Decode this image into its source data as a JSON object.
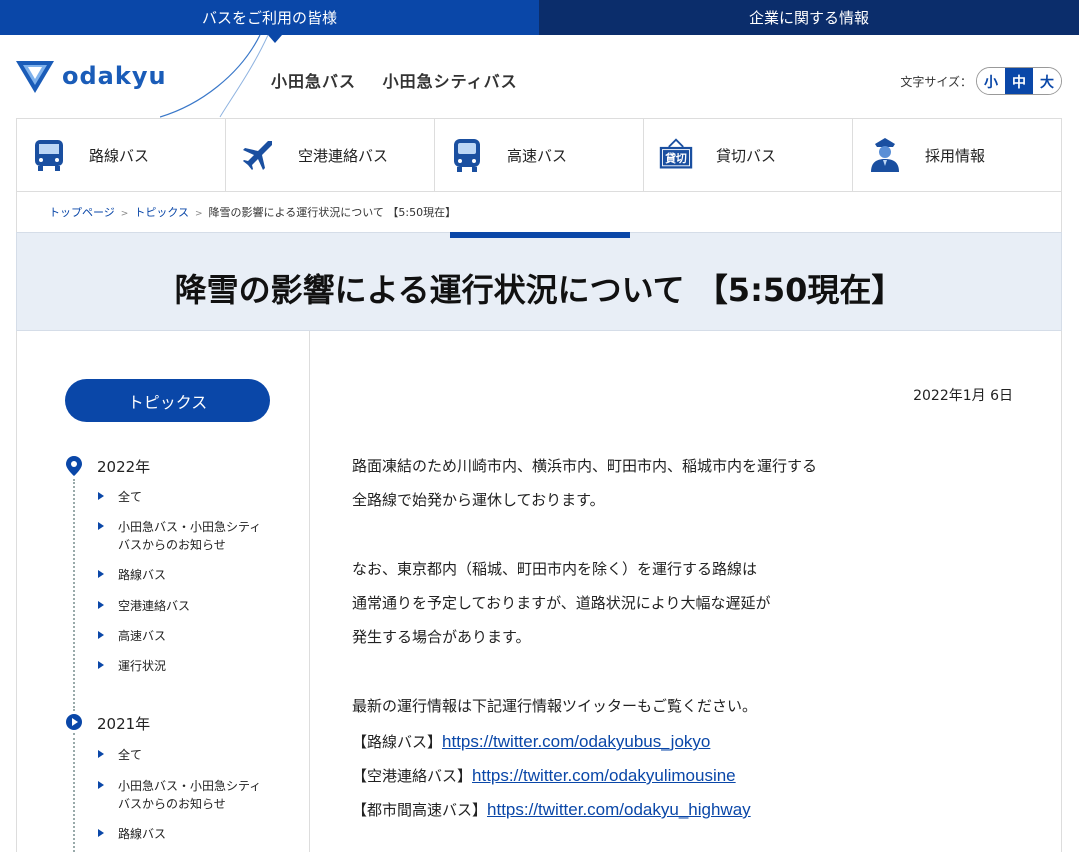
{
  "top_tabs": {
    "customer": "バスをご利用の皆様",
    "corporate": "企業に関する情報"
  },
  "header": {
    "logo_text": "odakyu",
    "company_1": "小田急バス",
    "company_2": "小田急シティバス",
    "fontsize_label": "文字サイズ：",
    "fontsize_small": "小",
    "fontsize_medium": "中",
    "fontsize_large": "大"
  },
  "nav": {
    "items": [
      {
        "label": "路線バス",
        "icon": "bus-front-icon"
      },
      {
        "label": "空港連絡バス",
        "icon": "airplane-icon"
      },
      {
        "label": "高速バス",
        "icon": "highway-bus-icon"
      },
      {
        "label": "貸切バス",
        "icon": "charter-sign-icon"
      },
      {
        "label": "採用情報",
        "icon": "staff-person-icon"
      }
    ]
  },
  "breadcrumb": {
    "home": "トップページ",
    "topics": "トピックス",
    "current": "降雪の影響による運行状況について 【5:50現在】"
  },
  "page_title": "降雪の影響による運行状況について 【5:50現在】",
  "sidebar": {
    "topics_button": "トピックス",
    "years": [
      {
        "year": "2022年",
        "categories": [
          "全て",
          "小田急バス・小田急シティバスからのお知らせ",
          "路線バス",
          "空港連絡バス",
          "高速バス",
          "運行状況"
        ]
      },
      {
        "year": "2021年",
        "categories": [
          "全て",
          "小田急バス・小田急シティバスからのお知らせ",
          "路線バス"
        ]
      }
    ]
  },
  "article": {
    "date": "2022年1月 6日",
    "para1_line1": "路面凍結のため川崎市内、横浜市内、町田市内、稲城市内を運行する",
    "para1_line2": "全路線で始発から運休しております。",
    "para2_line1": "なお、東京都内（稲城、町田市内を除く）を運行する路線は",
    "para2_line2": "通常通りを予定しておりますが、道路状況により大幅な遅延が",
    "para2_line3": "発生する場合があります。",
    "para3_line1": "最新の運行情報は下記運行情報ツイッターもご覧ください。",
    "links": [
      {
        "label": "【路線バス】",
        "url": "https://twitter.com/odakyubus_jokyo"
      },
      {
        "label": "【空港連絡バス】",
        "url": "https://twitter.com/odakyulimousine"
      },
      {
        "label": "【都市間高速バス】",
        "url": "https://twitter.com/odakyu_highway"
      }
    ]
  },
  "colors": {
    "brand_blue": "#0a47a8",
    "dark_navy": "#0b2d6b",
    "title_band_bg": "#e8eef6"
  }
}
